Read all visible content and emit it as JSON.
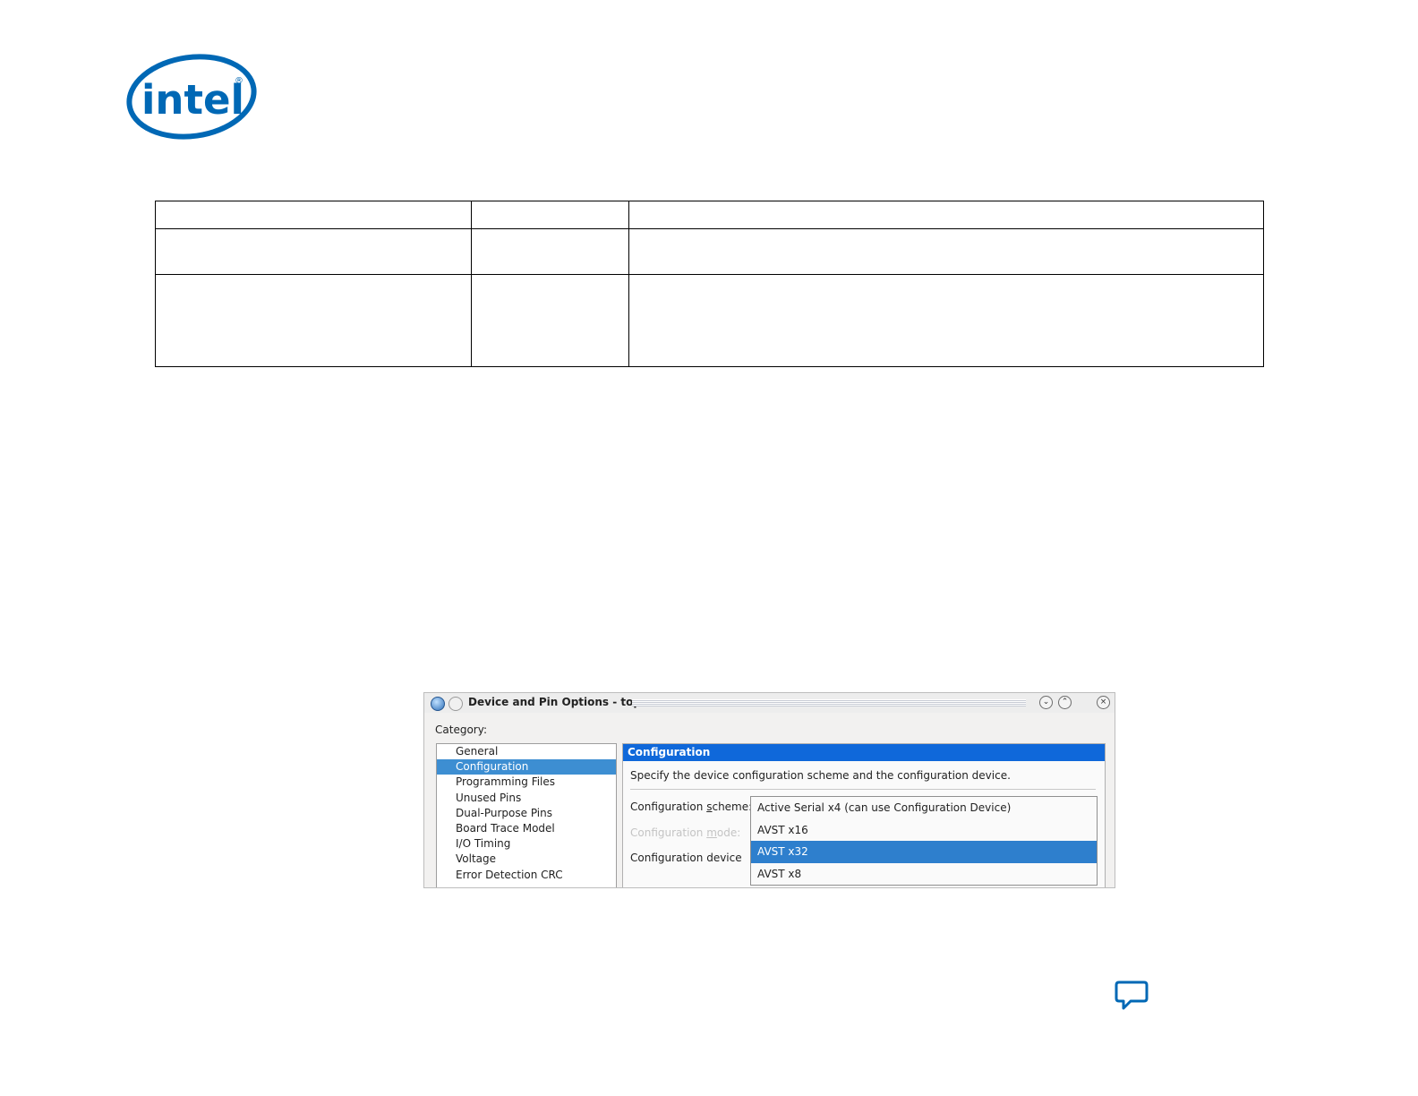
{
  "logo": {
    "text": "intel",
    "trademark": "®",
    "color": "#0068b5"
  },
  "dialog": {
    "title": "Device and Pin Options - top",
    "category_label": "Category:",
    "categories": [
      "General",
      "Configuration",
      "Programming Files",
      "Unused Pins",
      "Dual-Purpose Pins",
      "Board Trace Model",
      "I/O Timing",
      "Voltage",
      "Error Detection CRC"
    ],
    "selected_category": "Configuration",
    "panel": {
      "header": "Configuration",
      "description": "Specify the device configuration scheme and the configuration device.",
      "scheme_label_pre": "Configuration ",
      "scheme_label_key": "s",
      "scheme_label_post": "cheme:",
      "mode_label_pre": "Configuration ",
      "mode_label_key": "m",
      "mode_label_post": "ode:",
      "device_label": "Configuration device",
      "scheme_options": [
        "Active Serial x4 (can use Configuration Device)",
        "AVST x16",
        "AVST x32",
        "AVST x8"
      ],
      "selected_scheme": "AVST x32"
    },
    "window_buttons": {
      "minimize": "⌄",
      "maximize": "⌃",
      "close": "×"
    }
  },
  "colors": {
    "accent": "#0f68da",
    "selection": "#2e7fcd",
    "brand": "#0068b5"
  }
}
